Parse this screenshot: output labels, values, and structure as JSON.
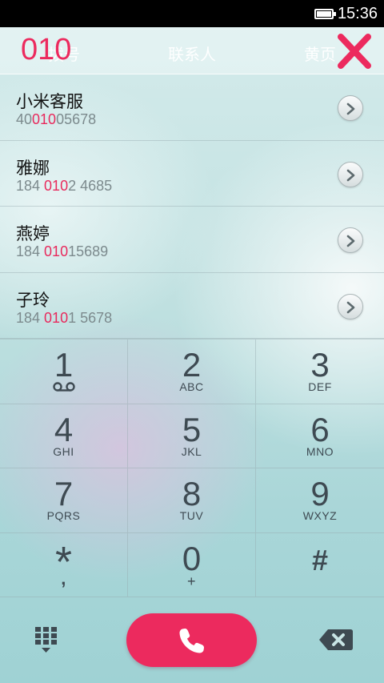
{
  "status_bar": {
    "time": "15:36"
  },
  "header": {
    "tabs": [
      {
        "label": "拨号"
      },
      {
        "label": "联系人"
      },
      {
        "label": "黄页"
      }
    ],
    "dial_input": "010"
  },
  "results": [
    {
      "name": "小米客服",
      "number_pre": "40",
      "number_match": "010",
      "number_post": "05678"
    },
    {
      "name": "雅娜",
      "number_pre": "184 ",
      "number_match": "010",
      "number_post": "2 4685"
    },
    {
      "name": "燕婷",
      "number_pre": "184 ",
      "number_match": "010",
      "number_post": "15689"
    },
    {
      "name": "子玲",
      "number_pre": "184 ",
      "number_match": "010",
      "number_post": "1 5678"
    }
  ],
  "keypad": [
    {
      "digit": "1",
      "letters": ""
    },
    {
      "digit": "2",
      "letters": "ABC"
    },
    {
      "digit": "3",
      "letters": "DEF"
    },
    {
      "digit": "4",
      "letters": "GHI"
    },
    {
      "digit": "5",
      "letters": "JKL"
    },
    {
      "digit": "6",
      "letters": "MNO"
    },
    {
      "digit": "7",
      "letters": "PQRS"
    },
    {
      "digit": "8",
      "letters": "TUV"
    },
    {
      "digit": "9",
      "letters": "WXYZ"
    },
    {
      "digit": "*",
      "letters": ","
    },
    {
      "digit": "0",
      "letters": "+"
    },
    {
      "digit": "#",
      "letters": ""
    }
  ],
  "icons": {
    "battery": "battery-icon",
    "clear": "close-icon",
    "detail": "chevron-right-icon",
    "voicemail": "voicemail-icon",
    "dialpad": "dialpad-icon",
    "call": "phone-icon",
    "backspace": "backspace-icon"
  },
  "colors": {
    "accent": "#ec2a5e",
    "key_text": "#3e4a52",
    "number_text": "#7c8a8d"
  }
}
